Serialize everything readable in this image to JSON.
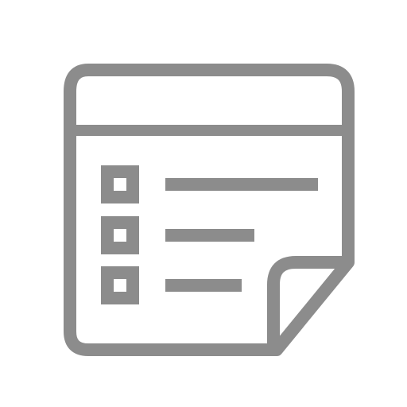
{
  "icon": {
    "name": "checklist-sticky-note-icon",
    "stroke_color": "#8c8c8c",
    "background_color": "#ffffff",
    "items": [
      {
        "checkbox": "checkbox-icon",
        "line": "list-line-long"
      },
      {
        "checkbox": "checkbox-icon",
        "line": "list-line-medium"
      },
      {
        "checkbox": "checkbox-icon",
        "line": "list-line-short"
      }
    ]
  }
}
